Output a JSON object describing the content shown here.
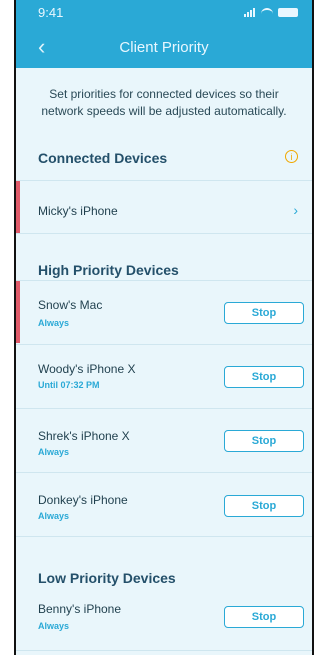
{
  "status": {
    "time": "9:41"
  },
  "nav": {
    "title": "Client Priority"
  },
  "description": "Set priorities for connected devices so their network speeds will be adjusted automatically.",
  "connected": {
    "heading": "Connected Devices",
    "device": "Micky's iPhone"
  },
  "high": {
    "heading": "High Priority Devices",
    "devices": [
      {
        "name": "Snow's Mac",
        "schedule": "Always",
        "action": "Stop"
      },
      {
        "name": "Woody's iPhone X",
        "schedule": "Until 07:32 PM",
        "action": "Stop"
      },
      {
        "name": "Shrek's iPhone X",
        "schedule": "Always",
        "action": "Stop"
      },
      {
        "name": "Donkey's iPhone",
        "schedule": "Always",
        "action": "Stop"
      }
    ]
  },
  "low": {
    "heading": "Low Priority Devices",
    "devices": [
      {
        "name": "Benny's iPhone",
        "schedule": "Always",
        "action": "Stop"
      }
    ]
  },
  "colors": {
    "accent_blue": "#2aa9d6",
    "accent_red": "#e05b6a",
    "info_orange": "#f0a800",
    "background": "#e9f6fb"
  }
}
